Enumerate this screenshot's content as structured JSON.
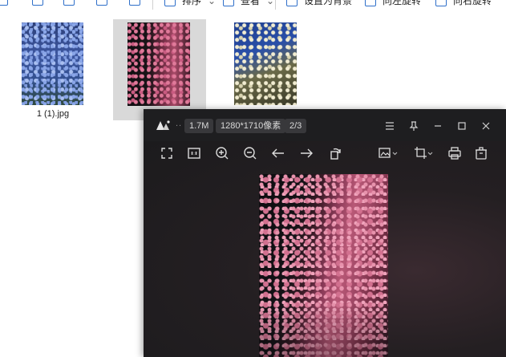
{
  "explorer": {
    "toolbar": {
      "sort_label": "排序",
      "view_label": "查看",
      "set_bg_label": "设置为背景",
      "rotate_left_label": "向左旋转",
      "rotate_right_label": "向右旋转"
    },
    "files": [
      {
        "name": "1 (1).jpg",
        "selected": false
      },
      {
        "name": "",
        "selected": true
      },
      {
        "name": "",
        "selected": false
      }
    ]
  },
  "viewer": {
    "file_size": "1.7M",
    "resolution": "1280*1710像素",
    "position": "2/3",
    "more": "..",
    "window_controls": [
      "menu-icon",
      "pin-icon",
      "minimize-icon",
      "maximize-icon",
      "close-icon"
    ],
    "tools": [
      "fullscreen-icon",
      "actual-size-icon",
      "zoom-in-icon",
      "zoom-out-icon",
      "previous-icon",
      "next-icon",
      "rotate-icon",
      "image-edit-icon",
      "crop-icon",
      "print-icon",
      "delete-icon"
    ],
    "colors": {
      "background": "#1e1e20",
      "badge": "#38383b",
      "icon": "#dcdcdc"
    }
  }
}
